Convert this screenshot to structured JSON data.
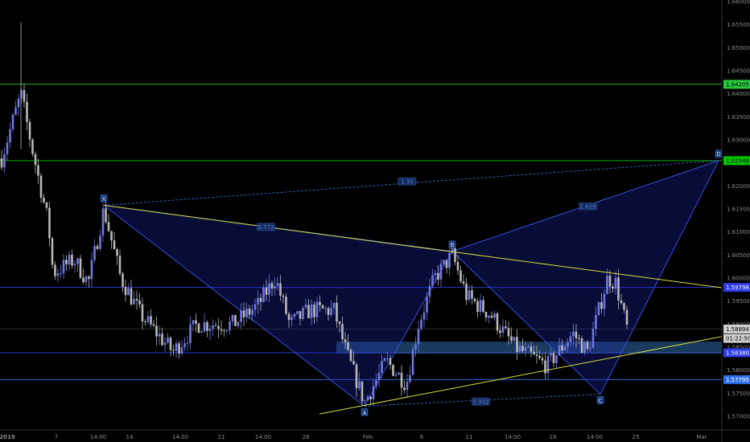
{
  "chart_data": {
    "type": "candlestick",
    "ylim": [
      1.567,
      1.661
    ],
    "y_ticks": [
      1.57,
      1.575,
      1.58,
      1.585,
      1.59,
      1.595,
      1.6,
      1.605,
      1.61,
      1.615,
      1.62,
      1.625,
      1.63,
      1.635,
      1.64,
      1.645,
      1.65,
      1.655,
      1.66
    ],
    "y_tick_labels": [
      "1.57000",
      "1.57500",
      "1.58000",
      "1.58500",
      "1.59000",
      "1.59500",
      "1.60000",
      "1.60500",
      "1.61000",
      "1.61500",
      "1.62000",
      "1.62500",
      "1.63000",
      "1.63500",
      "1.64000",
      "1.64500",
      "1.65000",
      "1.65500",
      "1.66000"
    ],
    "x_tick_labels": [
      "2019",
      "7",
      "14:00",
      "14",
      "14:00",
      "21",
      "14:00",
      "28",
      "Feb",
      "6",
      "11",
      "14:00",
      "18",
      "14:00",
      "25",
      "Mar"
    ],
    "price_tags": [
      {
        "label": "1.64205",
        "value": 1.64205,
        "color": "#27c93f",
        "line": true
      },
      {
        "label": "1.62548",
        "value": 1.62548,
        "color": "#00c800",
        "line": true
      },
      {
        "label": "1.59798",
        "value": 1.59798,
        "color": "#2f3de8",
        "line": true
      },
      {
        "label": "1.58894",
        "value": 1.58894,
        "color": "#cfcfcf",
        "line": false
      },
      {
        "label": "01:22:50",
        "value": 1.5869,
        "color": "#cfcfcf",
        "line": false
      },
      {
        "label": "1.58380",
        "value": 1.5838,
        "color": "#2f3de8",
        "line": true
      },
      {
        "label": "1.57795",
        "value": 1.57795,
        "color": "#2f6fe8",
        "line": true
      }
    ],
    "pattern_points": [
      {
        "label": "X",
        "value": 1.6158
      },
      {
        "label": "A",
        "value": 1.5722
      },
      {
        "label": "B",
        "value": 1.6058
      },
      {
        "label": "C",
        "value": 1.5748
      },
      {
        "label": "D",
        "value": 1.6255
      }
    ],
    "ratios": [
      "0.772",
      "0.932",
      "1.629",
      "1.35"
    ],
    "colors": {
      "pattern": "#2a3bd6",
      "trend": "#d7df3a",
      "green": "#27c93f",
      "blue": "#2f3de8",
      "candle_up": "#6f77e0",
      "candle_down": "#b8b8b8"
    }
  }
}
